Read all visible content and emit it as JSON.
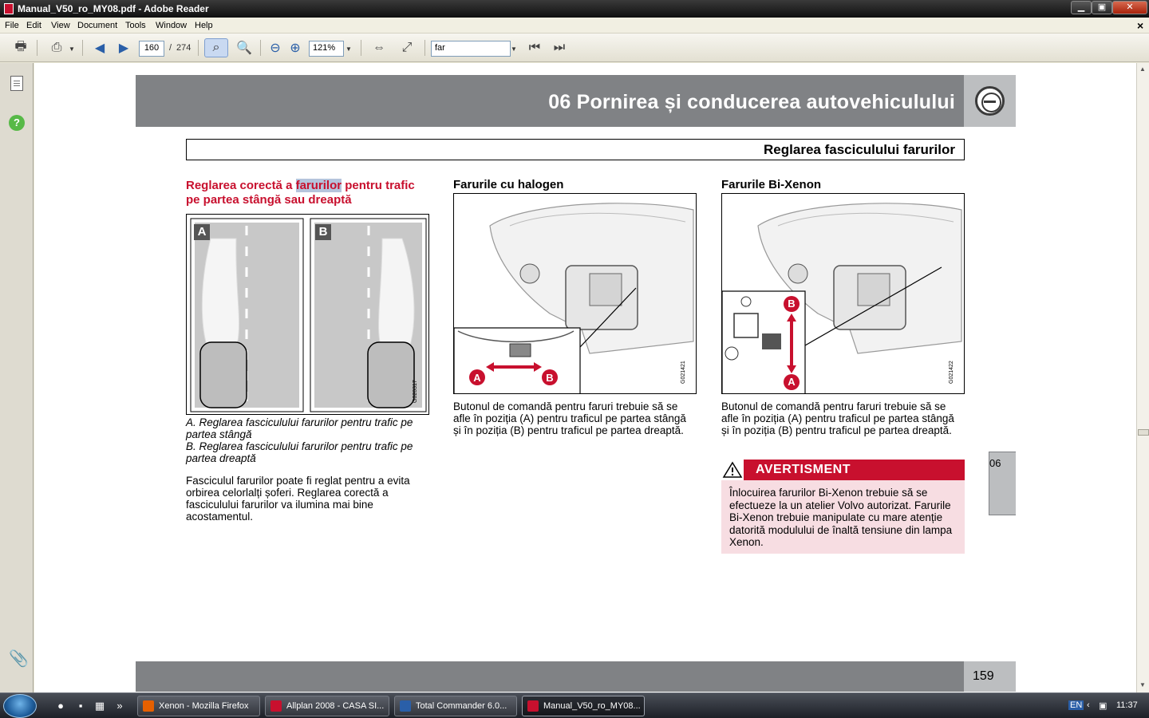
{
  "window": {
    "title": "Manual_V50_ro_MY08.pdf - Adobe Reader",
    "min_glyph": "▁",
    "max_glyph": "▣",
    "close_glyph": "✕"
  },
  "menu": [
    "File",
    "Edit",
    "View",
    "Document",
    "Tools",
    "Window",
    "Help"
  ],
  "menu_close_glyph": "×",
  "toolbar": {
    "page_current": "160",
    "page_sep": "/",
    "page_total": "274",
    "zoom": "121%",
    "search": "far",
    "dropdown_glyph": "▼"
  },
  "icons": {
    "print": "🖶",
    "prev": "◀",
    "next": "▶",
    "zoom_out": "⊖",
    "zoom_in": "⊕",
    "clip": "📎",
    "help": "?",
    "taskbar_overflow": "»"
  },
  "document": {
    "chapter_title": "06 Pornirea și conducerea autovehiculului",
    "section_title": "Reglarea fasciculului farurilor",
    "left_heading_pre": "Reglarea corectă a ",
    "left_heading_highlight": "farurilor",
    "left_heading_post": " pentru trafic pe partea stângă sau dreaptă",
    "fig1_label_a": "A",
    "fig1_label_b": "B",
    "fig1_code": "G020317",
    "caption_a": "A. Reglarea fasciculului farurilor pentru trafic pe partea stângă",
    "caption_b": "B. Reglarea fasciculului farurilor pentru trafic pe partea dreaptă",
    "left_body": "Fasciculul farurilor poate fi reglat pentru a evita orbirea celorlalți șoferi. Reglarea corectă a fasciculului farurilor va ilumina mai bine acostamentul.",
    "mid_heading": "Farurile cu halogen",
    "fig2_code": "G021421",
    "fig2_a": "A",
    "fig2_b": "B",
    "mid_body": "Butonul de comandă pentru faruri trebuie să se afle în poziția (A) pentru traficul pe partea stângă și în poziția (B) pentru traficul pe partea dreaptă.",
    "right_heading": "Farurile Bi-Xenon",
    "fig3_code": "G021422",
    "fig3_a": "A",
    "fig3_b": "B",
    "right_body": "Butonul de comandă pentru faruri trebuie să se afle în poziția (A) pentru traficul pe partea stângă și în poziția (B) pentru traficul pe partea dreaptă.",
    "side_tab": "06",
    "warning_label": "AVERTISMENT",
    "warning_body": "Înlocuirea farurilor Bi-Xenon trebuie să se efectueze la un atelier Volvo autorizat. Farurile Bi-Xenon trebuie manipulate cu mare atenție datorită modulului de înaltă tensiune din lampa Xenon.",
    "page_number": "159"
  },
  "taskbar": {
    "tasks": [
      {
        "label": "Xenon - Mozilla Firefox",
        "color": "#e66000"
      },
      {
        "label": "Allplan 2008 - CASA SI...",
        "color": "#c8102e"
      },
      {
        "label": "Total Commander 6.0...",
        "color": "#2a5fa8"
      },
      {
        "label": "Manual_V50_ro_MY08...",
        "color": "#c8102e"
      }
    ],
    "lang": "EN",
    "clock": "11:37"
  },
  "colors": {
    "accent_red": "#c8102e",
    "band_gray": "#808285",
    "light_gray": "#bcbec0",
    "warning_bg": "#f7dde2"
  }
}
